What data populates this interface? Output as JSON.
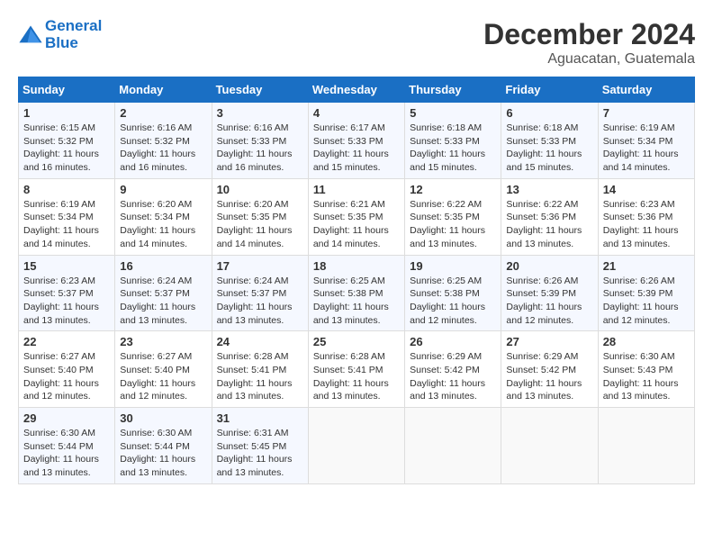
{
  "header": {
    "logo_line1": "General",
    "logo_line2": "Blue",
    "month_title": "December 2024",
    "subtitle": "Aguacatan, Guatemala"
  },
  "weekdays": [
    "Sunday",
    "Monday",
    "Tuesday",
    "Wednesday",
    "Thursday",
    "Friday",
    "Saturday"
  ],
  "weeks": [
    [
      {
        "day": "1",
        "info": "Sunrise: 6:15 AM\nSunset: 5:32 PM\nDaylight: 11 hours\nand 16 minutes."
      },
      {
        "day": "2",
        "info": "Sunrise: 6:16 AM\nSunset: 5:32 PM\nDaylight: 11 hours\nand 16 minutes."
      },
      {
        "day": "3",
        "info": "Sunrise: 6:16 AM\nSunset: 5:33 PM\nDaylight: 11 hours\nand 16 minutes."
      },
      {
        "day": "4",
        "info": "Sunrise: 6:17 AM\nSunset: 5:33 PM\nDaylight: 11 hours\nand 15 minutes."
      },
      {
        "day": "5",
        "info": "Sunrise: 6:18 AM\nSunset: 5:33 PM\nDaylight: 11 hours\nand 15 minutes."
      },
      {
        "day": "6",
        "info": "Sunrise: 6:18 AM\nSunset: 5:33 PM\nDaylight: 11 hours\nand 15 minutes."
      },
      {
        "day": "7",
        "info": "Sunrise: 6:19 AM\nSunset: 5:34 PM\nDaylight: 11 hours\nand 14 minutes."
      }
    ],
    [
      {
        "day": "8",
        "info": "Sunrise: 6:19 AM\nSunset: 5:34 PM\nDaylight: 11 hours\nand 14 minutes."
      },
      {
        "day": "9",
        "info": "Sunrise: 6:20 AM\nSunset: 5:34 PM\nDaylight: 11 hours\nand 14 minutes."
      },
      {
        "day": "10",
        "info": "Sunrise: 6:20 AM\nSunset: 5:35 PM\nDaylight: 11 hours\nand 14 minutes."
      },
      {
        "day": "11",
        "info": "Sunrise: 6:21 AM\nSunset: 5:35 PM\nDaylight: 11 hours\nand 14 minutes."
      },
      {
        "day": "12",
        "info": "Sunrise: 6:22 AM\nSunset: 5:35 PM\nDaylight: 11 hours\nand 13 minutes."
      },
      {
        "day": "13",
        "info": "Sunrise: 6:22 AM\nSunset: 5:36 PM\nDaylight: 11 hours\nand 13 minutes."
      },
      {
        "day": "14",
        "info": "Sunrise: 6:23 AM\nSunset: 5:36 PM\nDaylight: 11 hours\nand 13 minutes."
      }
    ],
    [
      {
        "day": "15",
        "info": "Sunrise: 6:23 AM\nSunset: 5:37 PM\nDaylight: 11 hours\nand 13 minutes."
      },
      {
        "day": "16",
        "info": "Sunrise: 6:24 AM\nSunset: 5:37 PM\nDaylight: 11 hours\nand 13 minutes."
      },
      {
        "day": "17",
        "info": "Sunrise: 6:24 AM\nSunset: 5:37 PM\nDaylight: 11 hours\nand 13 minutes."
      },
      {
        "day": "18",
        "info": "Sunrise: 6:25 AM\nSunset: 5:38 PM\nDaylight: 11 hours\nand 13 minutes."
      },
      {
        "day": "19",
        "info": "Sunrise: 6:25 AM\nSunset: 5:38 PM\nDaylight: 11 hours\nand 12 minutes."
      },
      {
        "day": "20",
        "info": "Sunrise: 6:26 AM\nSunset: 5:39 PM\nDaylight: 11 hours\nand 12 minutes."
      },
      {
        "day": "21",
        "info": "Sunrise: 6:26 AM\nSunset: 5:39 PM\nDaylight: 11 hours\nand 12 minutes."
      }
    ],
    [
      {
        "day": "22",
        "info": "Sunrise: 6:27 AM\nSunset: 5:40 PM\nDaylight: 11 hours\nand 12 minutes."
      },
      {
        "day": "23",
        "info": "Sunrise: 6:27 AM\nSunset: 5:40 PM\nDaylight: 11 hours\nand 12 minutes."
      },
      {
        "day": "24",
        "info": "Sunrise: 6:28 AM\nSunset: 5:41 PM\nDaylight: 11 hours\nand 13 minutes."
      },
      {
        "day": "25",
        "info": "Sunrise: 6:28 AM\nSunset: 5:41 PM\nDaylight: 11 hours\nand 13 minutes."
      },
      {
        "day": "26",
        "info": "Sunrise: 6:29 AM\nSunset: 5:42 PM\nDaylight: 11 hours\nand 13 minutes."
      },
      {
        "day": "27",
        "info": "Sunrise: 6:29 AM\nSunset: 5:42 PM\nDaylight: 11 hours\nand 13 minutes."
      },
      {
        "day": "28",
        "info": "Sunrise: 6:30 AM\nSunset: 5:43 PM\nDaylight: 11 hours\nand 13 minutes."
      }
    ],
    [
      {
        "day": "29",
        "info": "Sunrise: 6:30 AM\nSunset: 5:44 PM\nDaylight: 11 hours\nand 13 minutes."
      },
      {
        "day": "30",
        "info": "Sunrise: 6:30 AM\nSunset: 5:44 PM\nDaylight: 11 hours\nand 13 minutes."
      },
      {
        "day": "31",
        "info": "Sunrise: 6:31 AM\nSunset: 5:45 PM\nDaylight: 11 hours\nand 13 minutes."
      },
      {
        "day": "",
        "info": ""
      },
      {
        "day": "",
        "info": ""
      },
      {
        "day": "",
        "info": ""
      },
      {
        "day": "",
        "info": ""
      }
    ]
  ]
}
